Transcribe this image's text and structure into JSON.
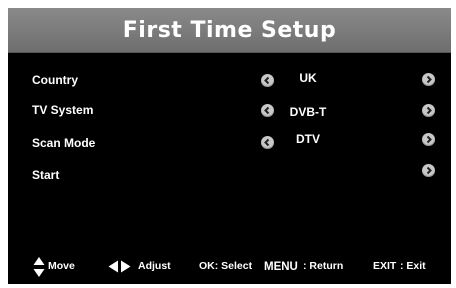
{
  "title": "First Time Setup",
  "settings": [
    {
      "label": "Country",
      "value": "UK",
      "has_left_arrow": true,
      "has_right_arrow": true
    },
    {
      "label": "TV System",
      "value": "DVB-T",
      "has_left_arrow": true,
      "has_right_arrow": true
    },
    {
      "label": "Scan Mode",
      "value": "DTV",
      "has_left_arrow": true,
      "has_right_arrow": true
    },
    {
      "label": "Start",
      "value": "",
      "has_left_arrow": false,
      "has_right_arrow": true
    }
  ],
  "footer": {
    "move_label": "Move",
    "adjust_label": "Adjust",
    "select_label": "OK: Select",
    "return_key": "MENU",
    "return_label": ": Return",
    "exit_key": "EXIT",
    "exit_label": ": Exit"
  },
  "icons": {
    "nav_left": "circle-left-arrow-icon",
    "nav_right": "circle-right-arrow-icon",
    "move": "up-down-triangle-icon",
    "adjust": "left-right-triangle-icon"
  },
  "colors": {
    "background": "#000000",
    "title_bar": "#7a7a7a",
    "text": "#ffffff",
    "arrow_button": "#c8c8c8"
  }
}
